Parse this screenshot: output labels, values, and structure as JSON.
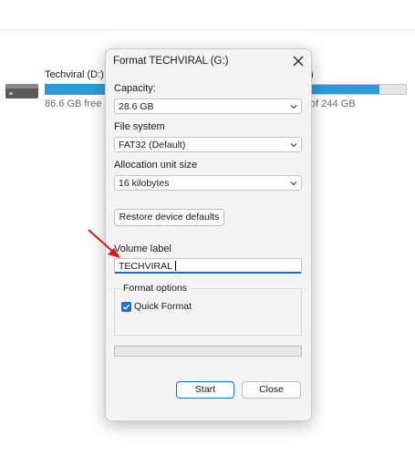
{
  "explorer": {
    "drive_left": {
      "name": "Techviral (D:)",
      "free_text": "86.6 GB free of 244 GB"
    },
    "drive_right": {
      "name": ")",
      "free_text": "of 244 GB",
      "used_fraction": 0.72
    },
    "accent": "#2e9bd9"
  },
  "dialog": {
    "title": "Format TECHVIRAL (G:)",
    "capacity": {
      "label": "Capacity:",
      "value": "28.6 GB"
    },
    "file_system": {
      "label": "File system",
      "value": "FAT32 (Default)"
    },
    "allocation": {
      "label": "Allocation unit size",
      "value": "16 kilobytes"
    },
    "restore_label": "Restore device defaults",
    "volume": {
      "label": "Volume label",
      "value": "TECHVIRAL"
    },
    "format_options": {
      "title": "Format options",
      "quick_format_label": "Quick Format",
      "quick_format_checked": true
    },
    "progress_fraction": 0,
    "start_label": "Start",
    "close_label": "Close",
    "accent": "#1f6fc8"
  },
  "icons": [
    "drive-icon",
    "close-icon",
    "chevron-down-icon",
    "checkmark-icon",
    "red-arrow-icon"
  ]
}
